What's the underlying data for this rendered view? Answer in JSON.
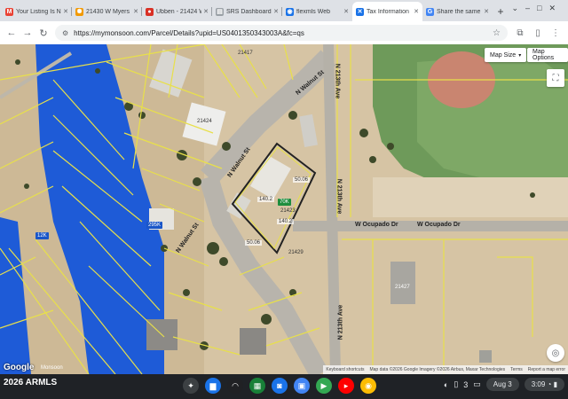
{
  "tabs": [
    {
      "label": "Your Listing Is N",
      "favicon": "gmail-icon",
      "color": "#ea4335",
      "glyph": "M"
    },
    {
      "label": "21430 W Myers",
      "favicon": "sun-icon",
      "color": "#f29900",
      "glyph": "✺"
    },
    {
      "label": "Ubben - 21424 W",
      "favicon": "circle-icon",
      "color": "#d93025",
      "glyph": "●"
    },
    {
      "label": "SRS Dashboard",
      "favicon": "doc-icon",
      "color": "#9aa0a6",
      "glyph": "▤"
    },
    {
      "label": "flexmls Web",
      "favicon": "pin-icon",
      "color": "#1a73e8",
      "glyph": "◉"
    },
    {
      "label": "Tax Information",
      "favicon": "tax-icon",
      "color": "#1a73e8",
      "glyph": "✕",
      "active": true
    },
    {
      "label": "Share the same",
      "favicon": "google-icon",
      "color": "#4285f4",
      "glyph": "G"
    }
  ],
  "url": "https://mymonsoon.com/Parcel/Details?upid=US0401350343003A&fc=qs",
  "map": {
    "map_size_label": "Map Size",
    "map_options_label": "Map Options",
    "streets": {
      "walnut_st_1": "N Walnut St",
      "walnut_st_2": "N Walnut St",
      "walnut_st_3": "N Walnut St",
      "ocupado_1": "W Ocupado Dr",
      "ocupado_2": "W Ocupado Dr",
      "ave_213_a": "N 213th Ave",
      "ave_213_b": "N 213th Ave",
      "ave_213_c": "N 213th Ave"
    },
    "dims": {
      "d1": "50.06",
      "d2": "140.2",
      "d3": "140.2",
      "d4": "50.06"
    },
    "parcel_labels": {
      "p1": "21417",
      "p2": "21424",
      "p3": "21423",
      "p4": "21429",
      "p5": "21427"
    },
    "badges": {
      "b1": "70K",
      "b2": "295K",
      "b3": "12K"
    },
    "google_label": "Google",
    "monsoon_label": "Monsoon",
    "attribution": {
      "shortcuts": "Keyboard shortcuts",
      "data": "Map data ©2026 Google Imagery ©2026 Airbus, Maxar Technologies",
      "terms": "Terms",
      "report": "Report a map error"
    }
  },
  "shelf": {
    "watermark": "2026 ARMLS",
    "date": "Aug 3",
    "time": "3:09",
    "notification_count": "3"
  }
}
